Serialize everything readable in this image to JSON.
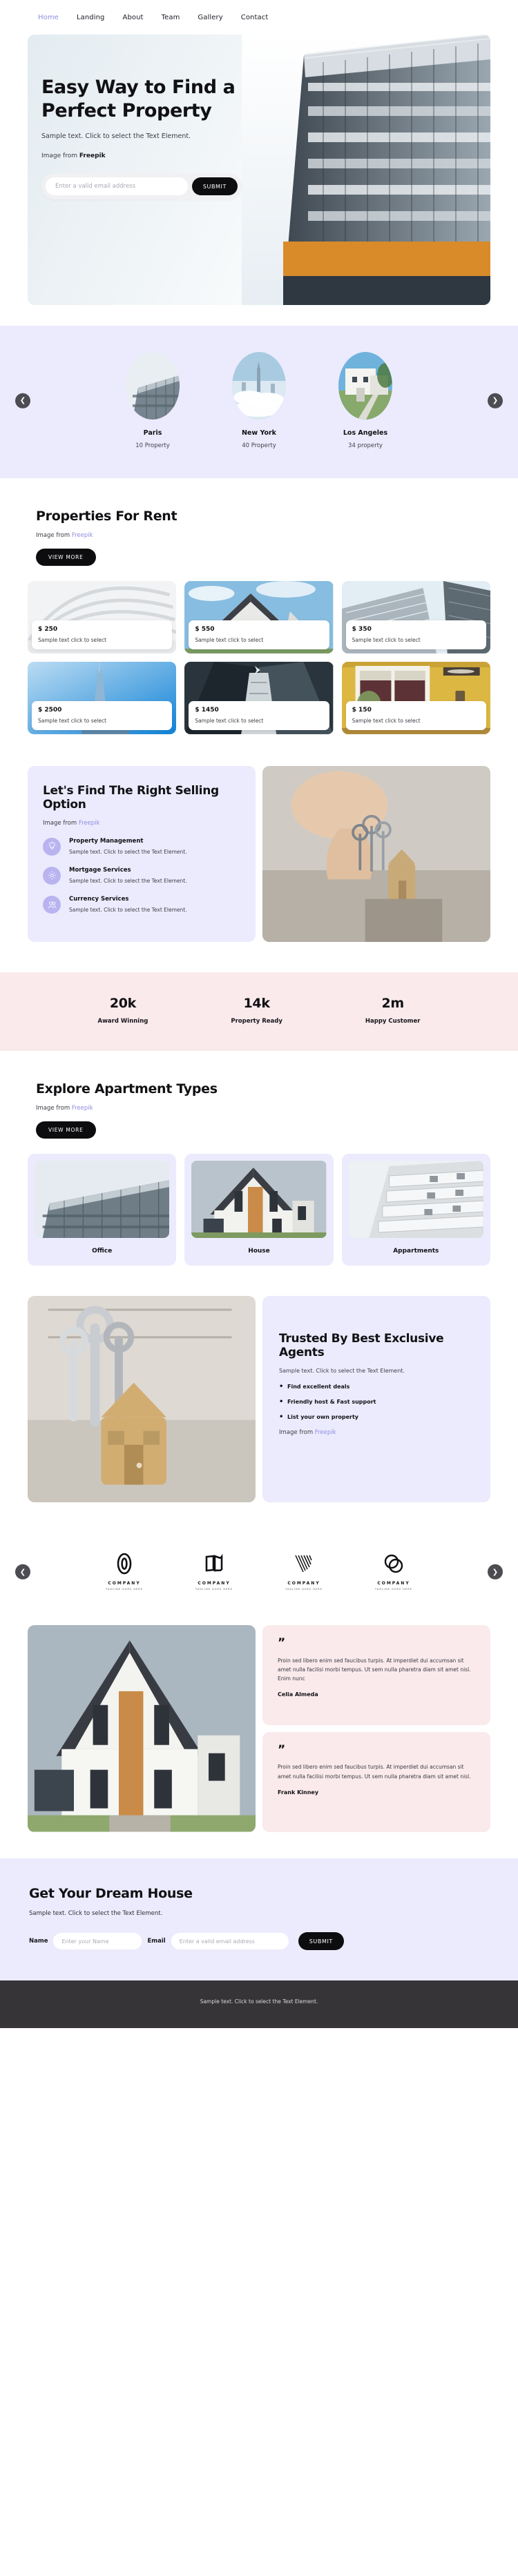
{
  "nav": {
    "items": [
      {
        "label": "Home",
        "active": true
      },
      {
        "label": "Landing",
        "active": false
      },
      {
        "label": "About",
        "active": false
      },
      {
        "label": "Team",
        "active": false
      },
      {
        "label": "Gallery",
        "active": false
      },
      {
        "label": "Contact",
        "active": false
      }
    ]
  },
  "hero": {
    "title": "Easy Way to Find a Perfect Property",
    "subtitle": "Sample text. Click to select the Text Element.",
    "credit_prefix": "Image from ",
    "credit_source": "Freepik",
    "email_placeholder": "Enter a valid email address",
    "submit_label": "SUBMIT"
  },
  "cities": {
    "prev_icon": "chevron-left-icon",
    "next_icon": "chevron-right-icon",
    "items": [
      {
        "name": "Paris",
        "count": "10 Property"
      },
      {
        "name": "New York",
        "count": "40 Property"
      },
      {
        "name": "Los Angeles",
        "count": "34 property"
      }
    ]
  },
  "properties": {
    "title": "Properties For Rent",
    "credit_prefix": "Image from ",
    "credit_source": "Freepik",
    "view_more_label": "VIEW MORE",
    "cards": [
      {
        "price": "$ 250",
        "desc": "Sample text click to select"
      },
      {
        "price": "$ 550",
        "desc": "Sample text click to select"
      },
      {
        "price": "$ 350",
        "desc": "Sample text click to select"
      },
      {
        "price": "$ 2500",
        "desc": "Sample text click to select"
      },
      {
        "price": "$ 1450",
        "desc": "Sample text click to select"
      },
      {
        "price": "$ 150",
        "desc": "Sample text click to select"
      }
    ]
  },
  "selling": {
    "title": "Let's Find The Right Selling Option",
    "credit_prefix": "Image from ",
    "credit_source": "Freepik",
    "features": [
      {
        "icon": "lightbulb-icon",
        "title": "Property Management",
        "text": "Sample text. Click to select the Text Element."
      },
      {
        "icon": "gear-icon",
        "title": "Mortgage Services",
        "text": "Sample text. Click to select the Text Element."
      },
      {
        "icon": "users-icon",
        "title": "Currency Services",
        "text": "Sample text. Click to select the Text Element."
      }
    ]
  },
  "stats": {
    "items": [
      {
        "value": "20k",
        "label": "Award Winning"
      },
      {
        "value": "14k",
        "label": "Property Ready"
      },
      {
        "value": "2m",
        "label": "Happy Customer"
      }
    ]
  },
  "apartments": {
    "title": "Explore Apartment Types",
    "credit_prefix": "Image from ",
    "credit_source": "Freepik",
    "view_more_label": "VIEW MORE",
    "types": [
      {
        "name": "Office"
      },
      {
        "name": "House"
      },
      {
        "name": "Appartments"
      }
    ]
  },
  "trusted": {
    "title": "Trusted By Best Exclusive Agents",
    "subtitle": "Sample text. Click to select the Text Element.",
    "bullets": [
      "Find excellent deals",
      "Friendly host & Fast support",
      "List your own property"
    ],
    "credit_prefix": "Image from ",
    "credit_source": "Freepik"
  },
  "logos": {
    "prev_icon": "chevron-left-icon",
    "next_icon": "chevron-right-icon",
    "items": [
      {
        "mark": "oval-knot-logo",
        "name": "COMPANY",
        "tagline": "TAGLINE GOES HERE"
      },
      {
        "mark": "book-open-logo",
        "name": "COMPANY",
        "tagline": "TAGLINE GOES HERE"
      },
      {
        "mark": "v-stripes-logo",
        "name": "COMPANY",
        "tagline": "TAGLINE GOES HERE"
      },
      {
        "mark": "double-ring-logo",
        "name": "COMPANY",
        "tagline": "TAGLINE GOES HERE"
      }
    ]
  },
  "testimonials": {
    "items": [
      {
        "quote_icon": "quote-icon",
        "text": "Proin sed libero enim sed faucibus turpis. At imperdiet dui accumsan sit amet nulla facilisi morbi tempus. Ut sem nulla pharetra diam sit amet nisl. Enim nunc",
        "name": "Celia Almeda"
      },
      {
        "quote_icon": "quote-icon",
        "text": "Proin sed libero enim sed faucibus turpis. At imperdiet dui accumsan sit amet nulla facilisi morbi tempus. Ut sem nulla pharetra diam sit amet nisl.",
        "name": "Frank Kinney"
      }
    ]
  },
  "cta": {
    "title": "Get Your Dream House",
    "subtitle": "Sample text. Click to select the Text Element.",
    "name_label": "Name",
    "name_placeholder": "Enter your Name",
    "email_label": "Email",
    "email_placeholder": "Enter a valid email address",
    "submit_label": "SUBMIT"
  },
  "footer": {
    "text": "Sample text. Click to select the Text Element."
  },
  "colors": {
    "accent_purple": "#8f8ce0",
    "panel_lavender": "#ecebfd",
    "panel_pink": "#faeaec",
    "dark": "#0d0d10",
    "footer_bg": "#373438"
  }
}
